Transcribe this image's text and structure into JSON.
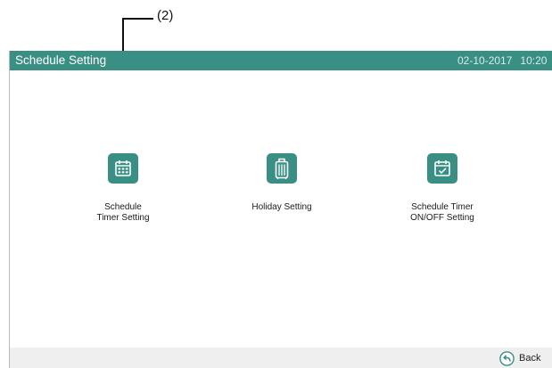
{
  "annotation": {
    "callout_label": "(2)"
  },
  "header": {
    "title": "Schedule Setting",
    "date": "02-10-2017",
    "time": "10:20"
  },
  "tiles": [
    {
      "icon": "calendar-grid-icon",
      "label_line1": "Schedule",
      "label_line2": "Timer Setting"
    },
    {
      "icon": "suitcase-icon",
      "label_line1": "Holiday Setting",
      "label_line2": ""
    },
    {
      "icon": "calendar-check-icon",
      "label_line1": "Schedule Timer",
      "label_line2": "ON/OFF Setting"
    }
  ],
  "footer": {
    "back_label": "Back",
    "back_icon": "back-arrow-icon"
  },
  "colors": {
    "accent": "#3a8f84",
    "footer_bg": "#efefef"
  }
}
